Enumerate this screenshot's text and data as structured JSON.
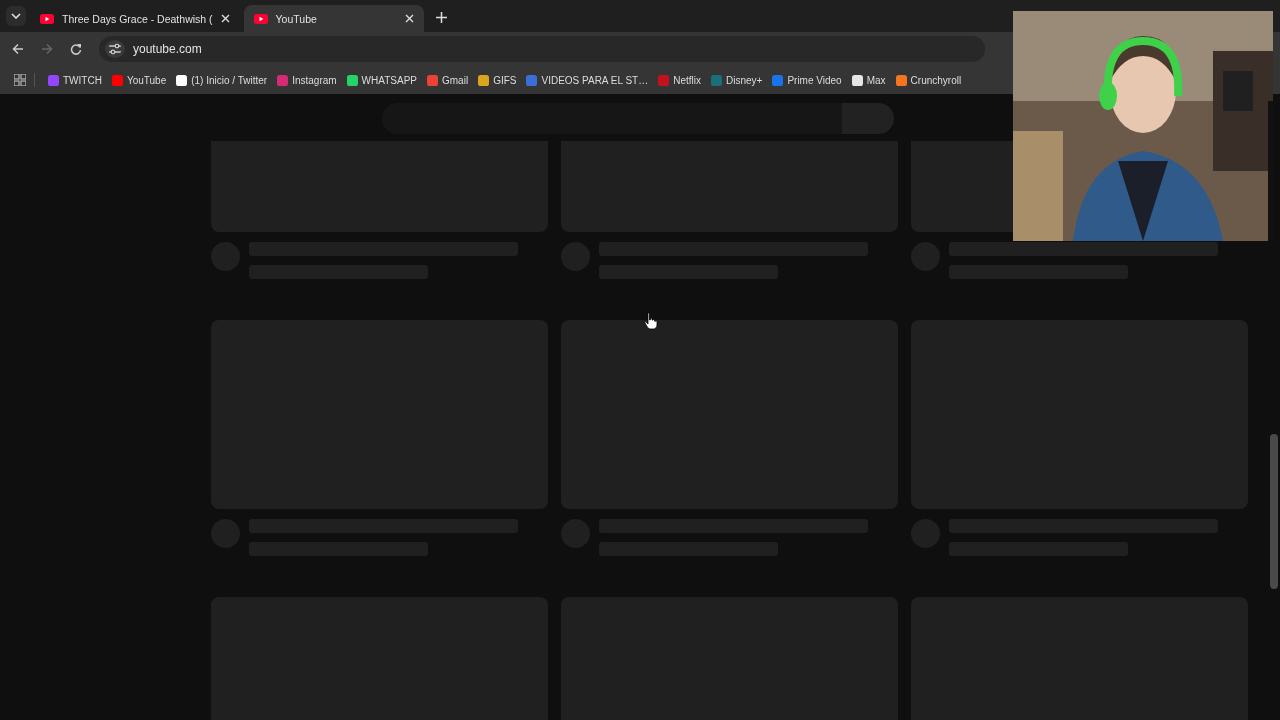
{
  "tabs": [
    {
      "title": "Three Days Grace - Deathwish (",
      "selected": false
    },
    {
      "title": "YouTube",
      "selected": true
    }
  ],
  "address_bar": {
    "url": "youtube.com"
  },
  "bookmarks": [
    {
      "label": "TWITCH",
      "color": "#9146ff"
    },
    {
      "label": "YouTube",
      "color": "#ff0000"
    },
    {
      "label": "(1) Inicio / Twitter",
      "color": "#ffffff"
    },
    {
      "label": "Instagram",
      "color": "#d62976"
    },
    {
      "label": "WHATSAPP",
      "color": "#25d366"
    },
    {
      "label": "Gmail",
      "color": "#ea4335"
    },
    {
      "label": "GIFS",
      "color": "#d9a520"
    },
    {
      "label": "VIDEOS PARA EL ST…",
      "color": "#3b6fd8"
    },
    {
      "label": "Netflix",
      "color": "#c3121b"
    },
    {
      "label": "Disney+",
      "color": "#1a6f7a"
    },
    {
      "label": "Prime Video",
      "color": "#1a73e8"
    },
    {
      "label": "Max",
      "color": "#e6e6e6"
    },
    {
      "label": "Crunchyroll",
      "color": "#f47521"
    }
  ]
}
